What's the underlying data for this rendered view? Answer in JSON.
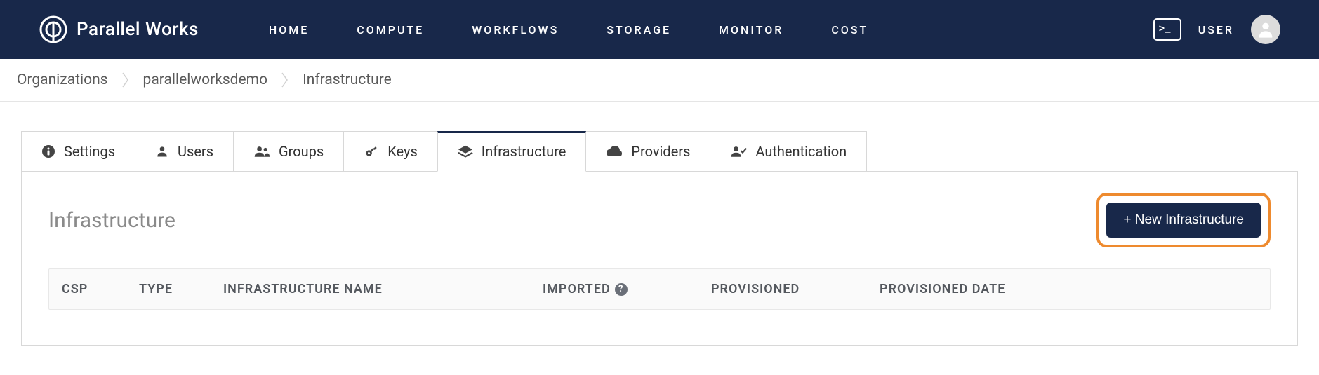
{
  "header": {
    "logo_text": "Parallel Works",
    "nav": [
      "HOME",
      "COMPUTE",
      "WORKFLOWS",
      "STORAGE",
      "MONITOR",
      "COST"
    ],
    "user_label": "USER"
  },
  "breadcrumb": [
    "Organizations",
    "parallelworksdemo",
    "Infrastructure"
  ],
  "tabs": [
    {
      "label": "Settings",
      "icon": "info"
    },
    {
      "label": "Users",
      "icon": "user"
    },
    {
      "label": "Groups",
      "icon": "users"
    },
    {
      "label": "Keys",
      "icon": "key"
    },
    {
      "label": "Infrastructure",
      "icon": "layers",
      "active": true
    },
    {
      "label": "Providers",
      "icon": "cloud"
    },
    {
      "label": "Authentication",
      "icon": "user-check"
    }
  ],
  "panel": {
    "title": "Infrastructure",
    "new_button": "+ New Infrastructure"
  },
  "table": {
    "headers": {
      "csp": "CSP",
      "type": "TYPE",
      "name": "INFRASTRUCTURE NAME",
      "imported": "IMPORTED",
      "provisioned": "PROVISIONED",
      "provisioned_date": "PROVISIONED DATE"
    }
  }
}
